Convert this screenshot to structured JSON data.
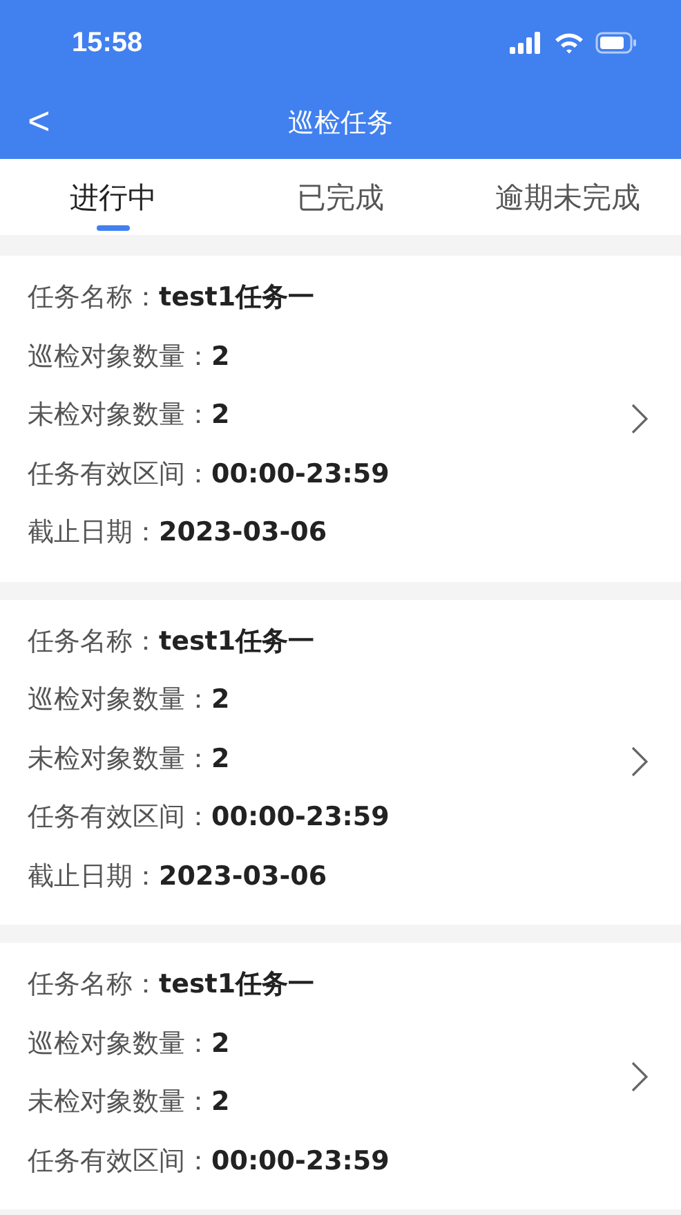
{
  "status_bar": {
    "time": "15:58"
  },
  "nav": {
    "back": "<",
    "title": "巡检任务"
  },
  "tabs": [
    {
      "label": "进行中",
      "selected": true
    },
    {
      "label": "已完成",
      "selected": false
    },
    {
      "label": "逾期未完成",
      "selected": false
    }
  ],
  "tasks": [
    {
      "fields": [
        {
          "label": "任务名称：",
          "value": "test1任务一"
        },
        {
          "label": "巡检对象数量：",
          "value": "2"
        },
        {
          "label": "未检对象数量：",
          "value": "2"
        },
        {
          "label": "任务有效区间：",
          "value": "00:00-23:59"
        },
        {
          "label": "截止日期：",
          "value": "2023-03-06"
        }
      ]
    },
    {
      "fields": [
        {
          "label": "任务名称：",
          "value": "test1任务一"
        },
        {
          "label": "巡检对象数量：",
          "value": "2"
        },
        {
          "label": "未检对象数量：",
          "value": "2"
        },
        {
          "label": "任务有效区间：",
          "value": "00:00-23:59"
        },
        {
          "label": "截止日期：",
          "value": "2023-03-06"
        }
      ]
    },
    {
      "fields": [
        {
          "label": "任务名称：",
          "value": "test1任务一"
        },
        {
          "label": "巡检对象数量：",
          "value": "2"
        },
        {
          "label": "未检对象数量：",
          "value": "2"
        },
        {
          "label": "任务有效区间：",
          "value": "00:00-23:59"
        }
      ]
    }
  ]
}
